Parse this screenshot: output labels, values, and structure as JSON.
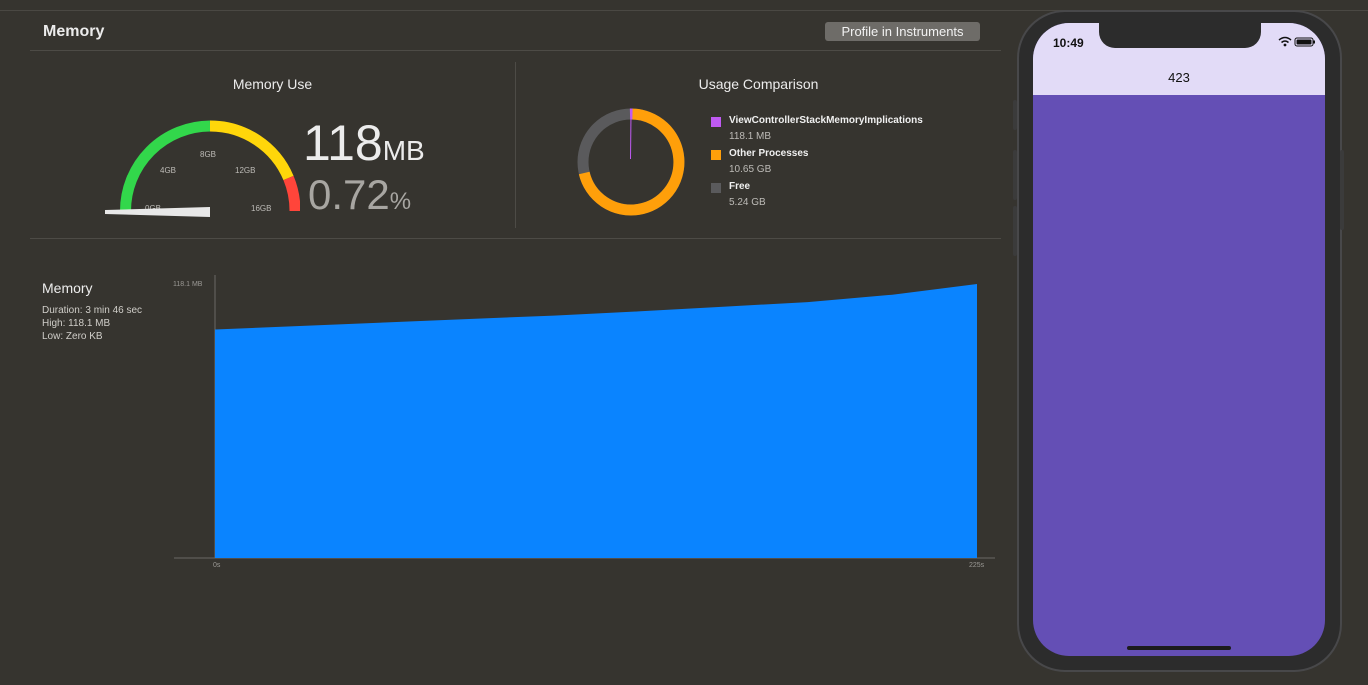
{
  "header": {
    "title": "Memory",
    "profile_button": "Profile in Instruments"
  },
  "memory_use": {
    "title": "Memory Use",
    "value": "118",
    "unit": "MB",
    "percent": "0.72",
    "percent_unit": "%",
    "gauge_labels": [
      "0GB",
      "4GB",
      "8GB",
      "12GB",
      "16GB"
    ],
    "gauge_level_fraction": 0.0072
  },
  "usage_comparison": {
    "title": "Usage Comparison",
    "legend": [
      {
        "name": "ViewControllerStackMemoryImplications",
        "value": "118.1 MB",
        "color": "#bf5af2"
      },
      {
        "name": "Other Processes",
        "value": "10.65 GB",
        "color": "#ff9f0a"
      },
      {
        "name": "Free",
        "value": "5.24 GB",
        "color": "#5a5a5c"
      }
    ]
  },
  "memory_graph": {
    "label": "Memory",
    "duration": "Duration: 3 min 46 sec",
    "high": "High: 118.1 MB",
    "low": "Low: Zero KB"
  },
  "chart_data": {
    "type": "area",
    "y_max_label": "118.1 MB",
    "x_start_label": "0s",
    "x_end_label": "225s",
    "x": [
      0,
      25,
      50,
      75,
      100,
      125,
      150,
      175,
      200,
      225
    ],
    "y": [
      98.5,
      100.0,
      101.5,
      103.0,
      104.5,
      106.3,
      108.3,
      110.3,
      113.5,
      118.1
    ],
    "ylim": [
      0,
      118.1
    ],
    "xlim": [
      0,
      225
    ],
    "color": "#0a84ff"
  },
  "phone": {
    "time": "10:49",
    "nav_title": "423",
    "background_color": "#644fb5",
    "navbar_color": "#e2dbf7"
  }
}
